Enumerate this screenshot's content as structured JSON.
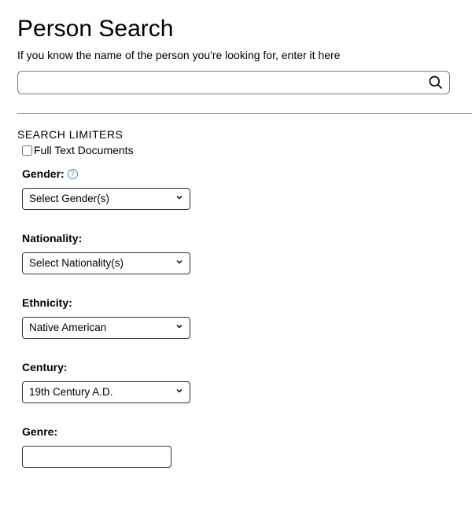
{
  "header": {
    "title": "Person Search",
    "subtitle": "If you know the name of the person you're looking for, enter it here"
  },
  "search": {
    "value": "",
    "icon": "search-icon"
  },
  "limiters": {
    "heading": "SEARCH LIMITERS",
    "fulltext": {
      "label": "Full Text Documents",
      "checked": false
    }
  },
  "fields": {
    "gender": {
      "label": "Gender:",
      "help": true,
      "selected": "Select Gender(s)"
    },
    "nationality": {
      "label": "Nationality:",
      "selected": "Select Nationality(s)"
    },
    "ethnicity": {
      "label": "Ethnicity:",
      "selected": "Native American"
    },
    "century": {
      "label": "Century:",
      "selected": "19th Century A.D."
    },
    "genre": {
      "label": "Genre:",
      "value": ""
    }
  }
}
